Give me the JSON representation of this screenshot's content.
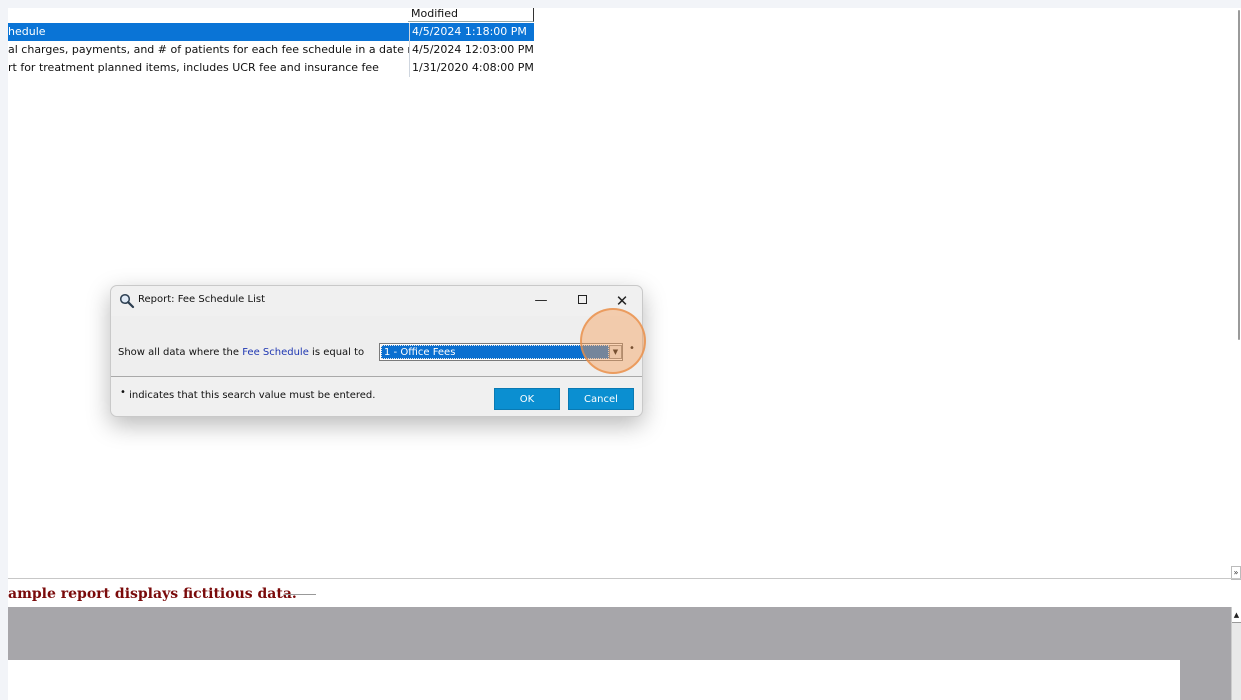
{
  "report_list": {
    "column_modified": "Modified",
    "rows": [
      {
        "description": "hedule",
        "modified": "4/5/2024 1:18:00 PM",
        "selected": true
      },
      {
        "description": "al charges, payments, and # of patients for each fee schedule in a date range",
        "modified": "4/5/2024 12:03:00 PM",
        "selected": false
      },
      {
        "description": "rt for treatment planned items, includes UCR fee and insurance fee",
        "modified": "1/31/2020 4:08:00 PM",
        "selected": false
      }
    ]
  },
  "sample_notice": "ample report displays fictitious data.",
  "dialog": {
    "title": "Report: Fee Schedule List",
    "minimize_symbol": "—",
    "close_symbol": "✕",
    "criteria": {
      "prefix": "Show all data where the",
      "field": "Fee Schedule",
      "operator": "is equal to",
      "value": "1 - Office Fees",
      "arrow_symbol": "▼",
      "required_marker": "•"
    },
    "note": {
      "bullet": "•",
      "text": "indicates that this search value must be entered."
    },
    "ok_label": "OK",
    "cancel_label": "Cancel"
  },
  "scroll_symbols": {
    "collapse": "»",
    "up": "▲"
  },
  "colors": {
    "selection": "#0a74d6",
    "button": "#0b8fd1",
    "field_link": "#1f37b2",
    "notice": "#7a0a0a",
    "highlight": "#f6a05a"
  },
  "icons": [
    "magnifier-icon",
    "minimize-icon",
    "maximize-icon",
    "close-icon",
    "dropdown-arrow-icon",
    "collapse-icon",
    "scroll-up-icon"
  ]
}
